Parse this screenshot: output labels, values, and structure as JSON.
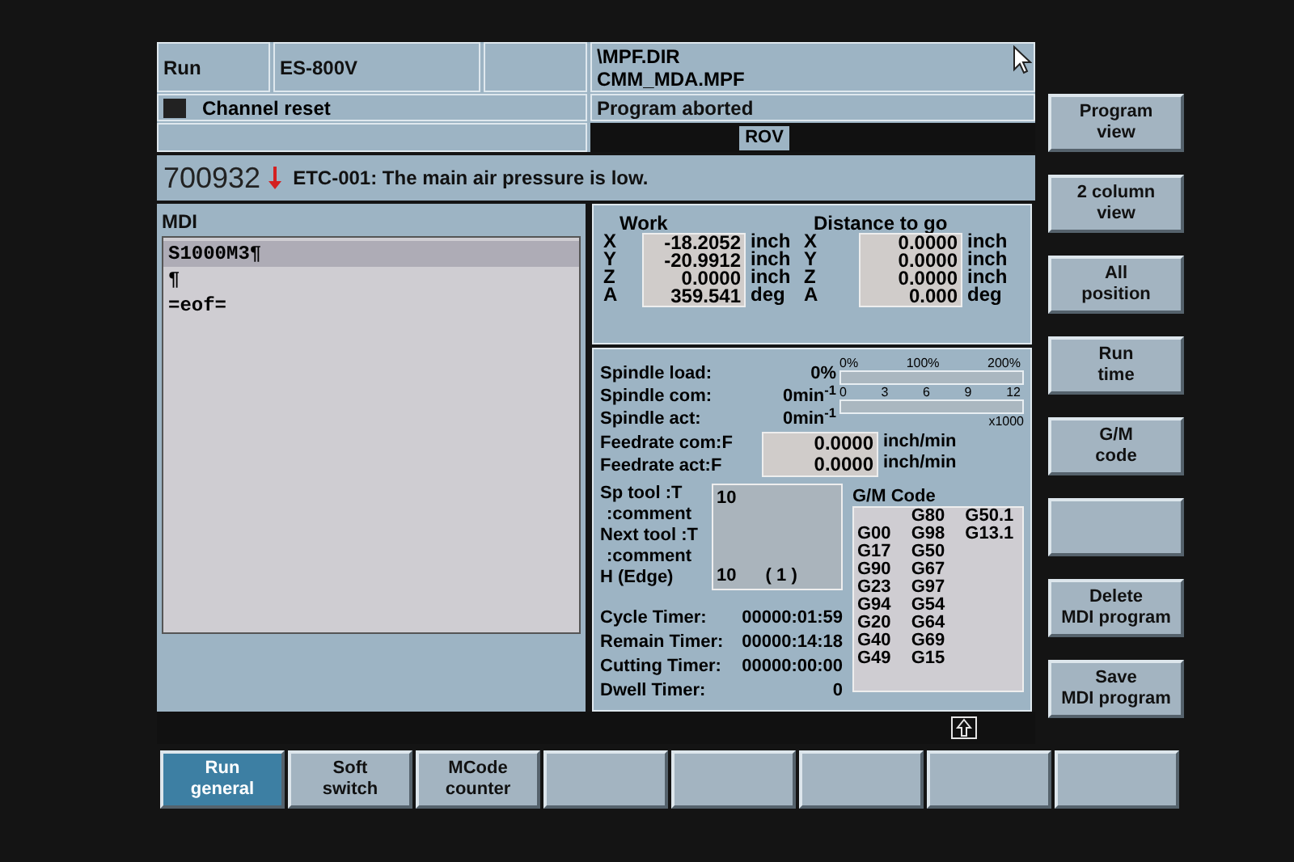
{
  "header": {
    "mode": "Run",
    "machine": "ES-800V",
    "program_path": [
      "\\MPF.DIR",
      "CMM_MDA.MPF"
    ],
    "channel_status": "Channel reset",
    "program_status": "Program aborted",
    "override": "ROV"
  },
  "alarm": {
    "number": "700932",
    "text": "ETC-001: The main air pressure is low."
  },
  "mdi": {
    "title": "MDI",
    "lines": [
      {
        "text": "S1000M3¶",
        "selected": true
      },
      {
        "text": "¶",
        "selected": false
      },
      {
        "text": "=eof=",
        "selected": false
      }
    ]
  },
  "position": {
    "work_title": "Work",
    "dtg_title": "Distance to go",
    "axes": [
      {
        "axis": "X",
        "work": "-18.2052",
        "work_unit": "inch",
        "dtg_axis": "X",
        "dtg": "0.0000",
        "dtg_unit": "inch"
      },
      {
        "axis": "Y",
        "work": "-20.9912",
        "work_unit": "inch",
        "dtg_axis": "Y",
        "dtg": "0.0000",
        "dtg_unit": "inch"
      },
      {
        "axis": "Z",
        "work": "0.0000",
        "work_unit": "inch",
        "dtg_axis": "Z",
        "dtg": "0.0000",
        "dtg_unit": "inch"
      },
      {
        "axis": "A",
        "work": "359.541",
        "work_unit": "deg",
        "dtg_axis": "A",
        "dtg": "0.000",
        "dtg_unit": "deg"
      }
    ]
  },
  "spindle": {
    "rows": [
      {
        "label": "Spindle load:",
        "value": "0%"
      },
      {
        "label": "Spindle com:",
        "value": "0min$^{-1}$"
      },
      {
        "label": "Spindle act:",
        "value": "0min$^{-1}$"
      }
    ],
    "load_meter": {
      "level": 0,
      "ticks": [
        "0%",
        "100%",
        "200%"
      ]
    },
    "speed_meter": {
      "level": 0,
      "ticks": [
        "0",
        "3",
        "6",
        "9",
        "12"
      ],
      "multiplier": "x1000"
    }
  },
  "feedrates": [
    {
      "label": "Feedrate com:F",
      "value": "0.0000",
      "unit": "inch/min"
    },
    {
      "label": "Feedrate act:F",
      "value": "0.0000",
      "unit": "inch/min"
    }
  ],
  "tools": {
    "labels": [
      "Sp tool :T",
      ":comment",
      "Next tool :T",
      ":comment",
      "H (Edge)"
    ],
    "sp_tool": "10",
    "h_edge": "10",
    "edge": "( 1 )"
  },
  "timers": [
    {
      "label": "Cycle Timer:",
      "value": "00000:01:59"
    },
    {
      "label": "Remain Timer:",
      "value": "00000:14:18"
    },
    {
      "label": "Cutting Timer:",
      "value": "00000:00:00"
    },
    {
      "label": "Dwell Timer:",
      "value": "0"
    }
  ],
  "gm_code": {
    "title": "G/M Code",
    "rows": [
      [
        null,
        "G80",
        "G50.1"
      ],
      [
        "G00",
        "G98",
        "G13.1"
      ],
      [
        "G17",
        "G50",
        null
      ],
      [
        "G90",
        "G67",
        null
      ],
      [
        "G23",
        "G97",
        null
      ],
      [
        "G94",
        "G54",
        null
      ],
      [
        "G20",
        "G64",
        null
      ],
      [
        "G40",
        "G69",
        null
      ],
      [
        "G49",
        "G15",
        null
      ]
    ]
  },
  "vertical_softkeys": [
    {
      "kind": "labeled",
      "label": "Program view"
    },
    {
      "kind": "labeled",
      "label": "2 column view"
    },
    {
      "kind": "labeled",
      "label": "All position"
    },
    {
      "kind": "labeled",
      "label": "Run time"
    },
    {
      "kind": "labeled",
      "label": "G/M code"
    },
    {
      "kind": "blank"
    },
    {
      "kind": "labeled",
      "label": "Delete MDI program"
    },
    {
      "kind": "labeled",
      "label": "Save MDI program"
    }
  ],
  "horizontal_softkeys": [
    {
      "label": "Run general",
      "selected": true
    },
    {
      "label": "Soft switch",
      "selected": false
    },
    {
      "label": "MCode counter",
      "selected": false
    },
    {
      "selected": false
    },
    {
      "selected": false
    },
    {
      "selected": false
    },
    {
      "selected": false
    },
    {
      "selected": false
    }
  ]
}
